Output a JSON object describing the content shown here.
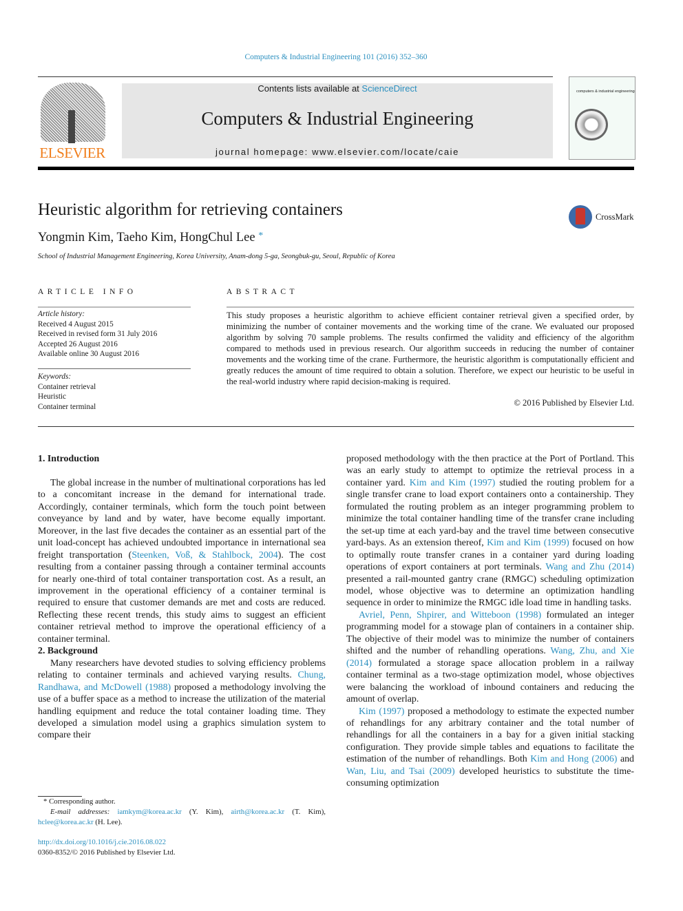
{
  "header": {
    "citation": "Computers & Industrial Engineering 101 (2016) 352–360",
    "publisher_logo_text": "ELSEVIER",
    "contents_prefix": "Contents lists available at ",
    "contents_link": "ScienceDirect",
    "journal_title": "Computers & Industrial Engineering",
    "homepage": "journal homepage: www.elsevier.com/locate/caie",
    "cover_text": "computers & industrial engineering",
    "crossmark_label": "CrossMark"
  },
  "article": {
    "title": "Heuristic algorithm for retrieving containers",
    "authors": "Yongmin Kim, Taeho Kim, HongChul Lee",
    "author_mark": "*",
    "affiliation": "School of Industrial Management Engineering, Korea University, Anam-dong 5-ga, Seongbuk-gu, Seoul, Republic of Korea"
  },
  "article_info": {
    "heading": "ARTICLE INFO",
    "history_label": "Article history:",
    "history": [
      "Received 4 August 2015",
      "Received in revised form 31 July 2016",
      "Accepted 26 August 2016",
      "Available online 30 August 2016"
    ],
    "keywords_label": "Keywords:",
    "keywords": [
      "Container retrieval",
      "Heuristic",
      "Container terminal"
    ]
  },
  "abstract": {
    "heading": "ABSTRACT",
    "text": "This study proposes a heuristic algorithm to achieve efficient container retrieval given a specified order, by minimizing the number of container movements and the working time of the crane. We evaluated our proposed algorithm by solving 70 sample problems. The results confirmed the validity and efficiency of the algorithm compared to methods used in previous research. Our algorithm succeeds in reducing the number of container movements and the working time of the crane. Furthermore, the heuristic algorithm is computationally efficient and greatly reduces the amount of time required to obtain a solution. Therefore, we expect our heuristic to be useful in the real-world industry where rapid decision-making is required.",
    "copyright": "© 2016 Published by Elsevier Ltd."
  },
  "body": {
    "left": [
      {
        "type": "h",
        "text": "1. Introduction"
      },
      {
        "type": "p",
        "segs": [
          {
            "t": "The global increase in the number of multinational corporations has led to a concomitant increase in the demand for international trade. Accordingly, container terminals, which form the touch point between conveyance by land and by water, have become equally important. Moreover, in the last five decades the container as an essential part of the unit load-concept has achieved undoubted importance in international sea freight transportation ("
          },
          {
            "t": "Steenken, Voß, & Stahlbock, 2004",
            "link": true
          },
          {
            "t": "). The cost resulting from a container passing through a container terminal accounts for nearly one-third of total container transportation cost. As a result, an improvement in the operational efficiency of a container terminal is required to ensure that customer demands are met and costs are reduced. Reflecting these recent trends, this study aims to suggest an efficient container retrieval method to improve the operational efficiency of a container terminal."
          }
        ]
      },
      {
        "type": "h",
        "text": "2. Background"
      },
      {
        "type": "p",
        "segs": [
          {
            "t": "Many researchers have devoted studies to solving efficiency problems relating to container terminals and achieved varying results. "
          },
          {
            "t": "Chung, Randhawa, and McDowell (1988)",
            "link": true
          },
          {
            "t": " proposed a methodology involving the use of a buffer space as a method to increase the utilization of the material handling equipment and reduce the total container loading time. They developed a simulation model using a graphics simulation system to compare their"
          }
        ]
      }
    ],
    "right": [
      {
        "type": "p",
        "noindent": true,
        "segs": [
          {
            "t": "proposed methodology with the then practice at the Port of Portland. This was an early study to attempt to optimize the retrieval process in a container yard. "
          },
          {
            "t": "Kim and Kim (1997)",
            "link": true
          },
          {
            "t": " studied the routing problem for a single transfer crane to load export containers onto a containership. They formulated the routing problem as an integer programming problem to minimize the total container handling time of the transfer crane including the set-up time at each yard-bay and the travel time between consecutive yard-bays. As an extension thereof, "
          },
          {
            "t": "Kim and Kim (1999)",
            "link": true
          },
          {
            "t": " focused on how to optimally route transfer cranes in a container yard during loading operations of export containers at port terminals. "
          },
          {
            "t": "Wang and Zhu (2014)",
            "link": true
          },
          {
            "t": " presented a rail-mounted gantry crane (RMGC) scheduling optimization model, whose objective was to determine an optimization handling sequence in order to minimize the RMGC idle load time in handling tasks."
          }
        ]
      },
      {
        "type": "p",
        "segs": [
          {
            "t": "Avriel, Penn, Shpirer, and Witteboon (1998)",
            "link": true
          },
          {
            "t": " formulated an integer programming model for a stowage plan of containers in a container ship. The objective of their model was to minimize the number of containers shifted and the number of rehandling operations. "
          },
          {
            "t": "Wang, Zhu, and Xie (2014)",
            "link": true
          },
          {
            "t": " formulated a storage space allocation problem in a railway container terminal as a two-stage optimization model, whose objectives were balancing the workload of inbound containers and reducing the amount of overlap."
          }
        ]
      },
      {
        "type": "p",
        "segs": [
          {
            "t": "Kim (1997)",
            "link": true
          },
          {
            "t": " proposed a methodology to estimate the expected number of rehandlings for any arbitrary container and the total number of rehandlings for all the containers in a bay for a given initial stacking configuration. They provide simple tables and equations to facilitate the estimation of the number of rehandlings. Both "
          },
          {
            "t": "Kim and Hong (2006)",
            "link": true
          },
          {
            "t": " and "
          },
          {
            "t": "Wan, Liu, and Tsai (2009)",
            "link": true
          },
          {
            "t": " developed heuristics to substitute the time-consuming optimization"
          }
        ]
      }
    ]
  },
  "footnote": {
    "corresponding": "* Corresponding author.",
    "email_label": "E-mail addresses:",
    "emails": [
      {
        "addr": "iamkym@korea.ac.kr",
        "who": " (Y. Kim), "
      },
      {
        "addr": "airth@korea.ac.kr",
        "who": " (T. Kim),"
      },
      {
        "addr": "hclee@korea.ac.kr",
        "who": " (H. Lee)."
      }
    ],
    "doi": "http://dx.doi.org/10.1016/j.cie.2016.08.022",
    "issn": "0360-8352/© 2016 Published by Elsevier Ltd."
  },
  "colors": {
    "link": "#2a8fbf",
    "elsevier_orange": "#f07d1a",
    "banner": "#e6e6e6"
  }
}
